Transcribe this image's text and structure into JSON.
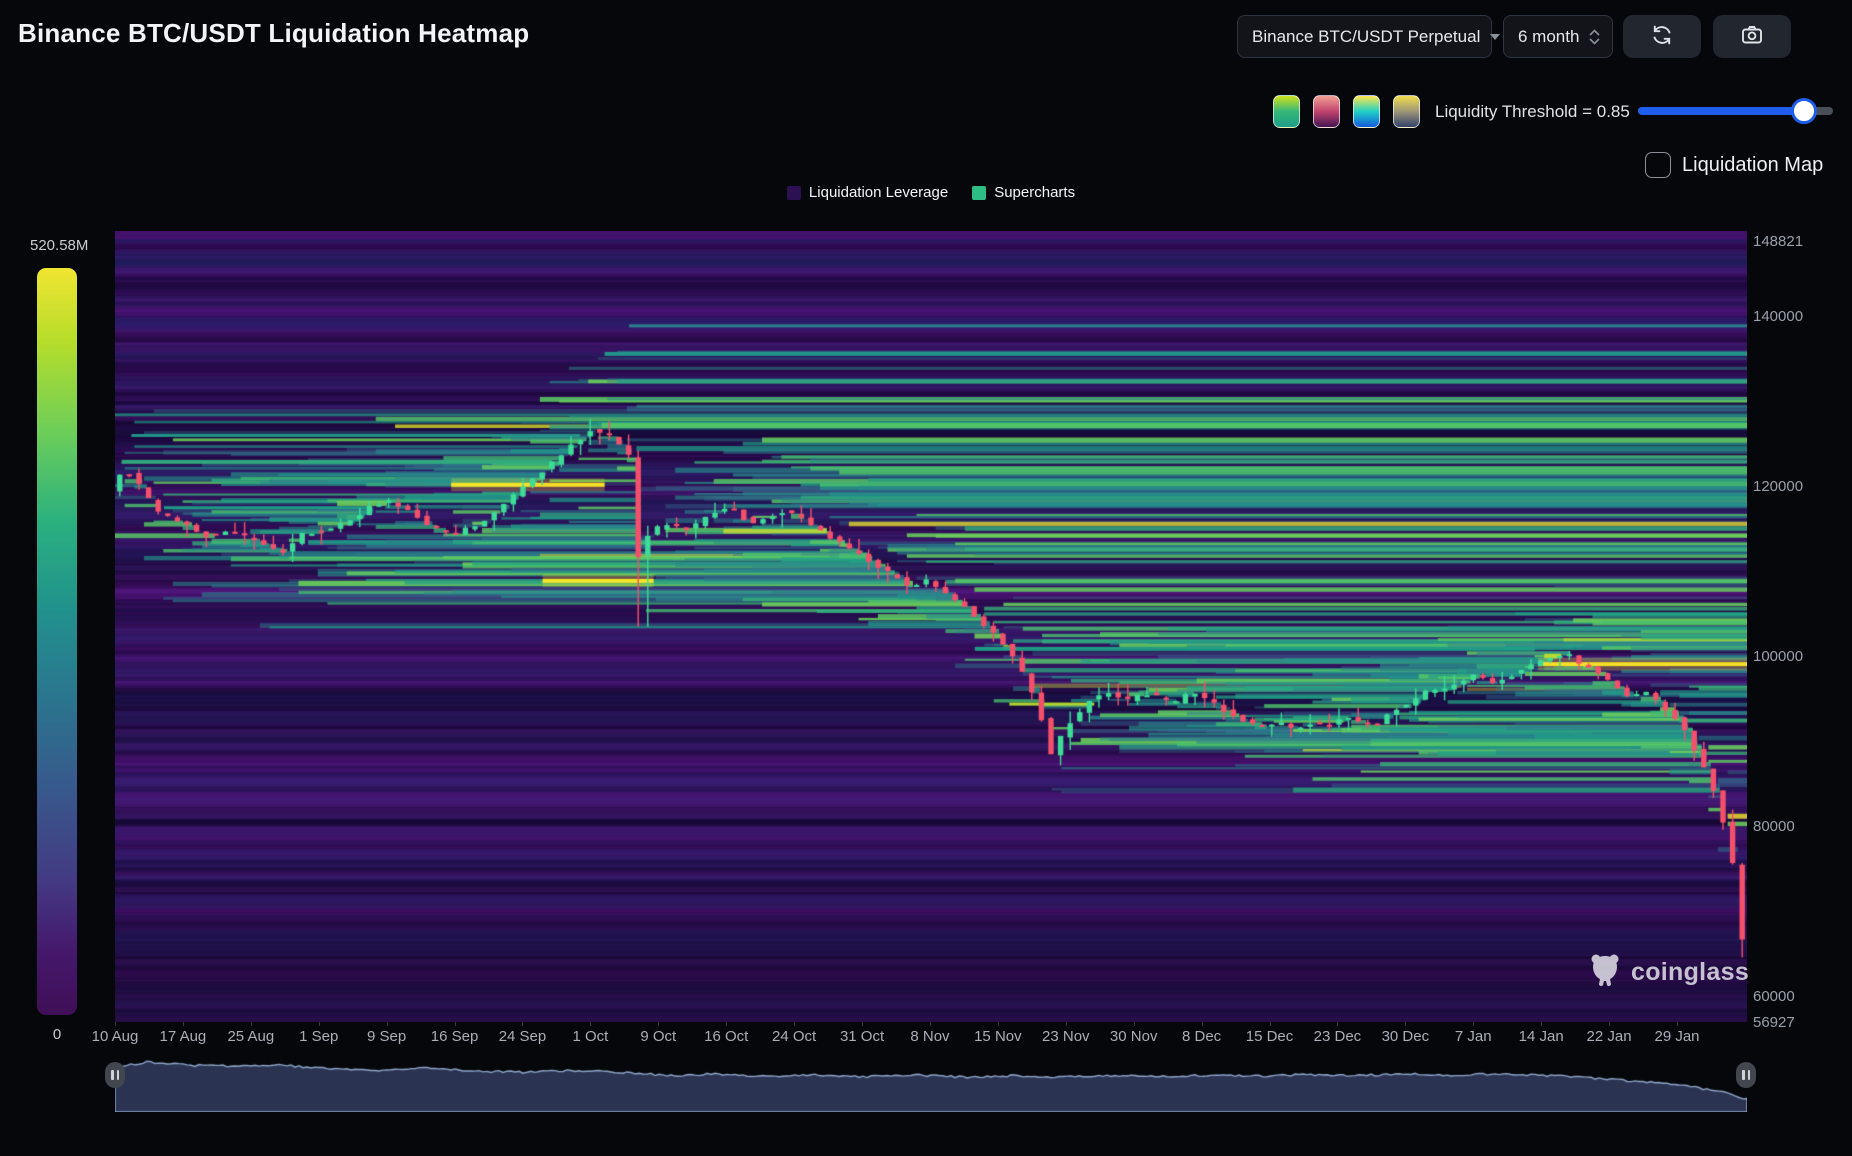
{
  "header": {
    "title": "Binance BTC/USDT Liquidation Heatmap"
  },
  "toolbar": {
    "symbol_select_value": "Binance BTC/USDT Perpetual",
    "range_select_value": "6 month"
  },
  "controls": {
    "threshold_label": "Liquidity Threshold = 0.85",
    "threshold_value": 0.85,
    "accent_blue": "#1f5eec",
    "palettes": [
      {
        "name": "viridis",
        "gradient": [
          "#cfe11e",
          "#35b779",
          "#1f9e89"
        ]
      },
      {
        "name": "magma",
        "gradient": [
          "#f2a093",
          "#c0436f",
          "#431453"
        ]
      },
      {
        "name": "ocean",
        "gradient": [
          "#ffe94d",
          "#20d0c4",
          "#1459dd"
        ]
      },
      {
        "name": "cividis",
        "gradient": [
          "#f3dd4d",
          "#9c9677",
          "#33426b"
        ]
      }
    ],
    "map_checkbox_label": "Liquidation Map",
    "map_checkbox_checked": false
  },
  "legend": [
    {
      "label": "Liquidation Leverage",
      "color": "#2d1052"
    },
    {
      "label": "Supercharts",
      "color": "#2ebd85"
    }
  ],
  "watermark": {
    "text": "coinglass"
  },
  "chart_data": {
    "type": "heatmap",
    "title": "Binance BTC/USDT Liquidation Heatmap",
    "colorbar": {
      "max_label": "520.58M",
      "min_label": "0"
    },
    "palette_stops": [
      "#440154",
      "#48327e",
      "#3e5c8a",
      "#31798e",
      "#26908d",
      "#1fa187",
      "#4ac16d",
      "#6dce59",
      "#b4de2c",
      "#fde725"
    ],
    "y_axis": {
      "side": "right",
      "min": 56927,
      "max": 148821,
      "ticks": [
        "148821",
        "140000",
        "120000",
        "100000",
        "80000",
        "60000",
        "56927"
      ]
    },
    "x_axis": {
      "labels": [
        "10 Aug",
        "17 Aug",
        "25 Aug",
        "1 Sep",
        "9 Sep",
        "16 Sep",
        "24 Sep",
        "1 Oct",
        "9 Oct",
        "16 Oct",
        "24 Oct",
        "31 Oct",
        "8 Nov",
        "15 Nov",
        "23 Nov",
        "30 Nov",
        "8 Dec",
        "15 Dec",
        "23 Dec",
        "30 Dec",
        "7 Jan",
        "14 Jan",
        "22 Jan",
        "29 Jan"
      ]
    },
    "candle_up_color": "#3ddc97",
    "candle_down_color": "#f4506b",
    "background_color": "#43106a",
    "price_path": [
      [
        0,
        118600
      ],
      [
        0.008,
        121200
      ],
      [
        0.018,
        119000
      ],
      [
        0.03,
        115800
      ],
      [
        0.045,
        114600
      ],
      [
        0.06,
        113100
      ],
      [
        0.075,
        113700
      ],
      [
        0.09,
        112400
      ],
      [
        0.105,
        111300
      ],
      [
        0.118,
        113400
      ],
      [
        0.132,
        113900
      ],
      [
        0.147,
        115000
      ],
      [
        0.162,
        116900
      ],
      [
        0.172,
        117300
      ],
      [
        0.183,
        116200
      ],
      [
        0.196,
        114200
      ],
      [
        0.21,
        113400
      ],
      [
        0.225,
        114500
      ],
      [
        0.24,
        116700
      ],
      [
        0.255,
        119300
      ],
      [
        0.27,
        121700
      ],
      [
        0.284,
        124100
      ],
      [
        0.296,
        125800
      ],
      [
        0.306,
        124800
      ],
      [
        0.314,
        123600
      ],
      [
        0.319,
        122200
      ],
      [
        0.323,
        110600
      ],
      [
        0.328,
        113200
      ],
      [
        0.34,
        114700
      ],
      [
        0.355,
        114000
      ],
      [
        0.37,
        115900
      ],
      [
        0.38,
        116500
      ],
      [
        0.392,
        114600
      ],
      [
        0.402,
        115200
      ],
      [
        0.412,
        116100
      ],
      [
        0.422,
        115500
      ],
      [
        0.436,
        113600
      ],
      [
        0.45,
        112000
      ],
      [
        0.465,
        110200
      ],
      [
        0.478,
        108700
      ],
      [
        0.49,
        107100
      ],
      [
        0.5,
        107900
      ],
      [
        0.512,
        106300
      ],
      [
        0.523,
        104900
      ],
      [
        0.533,
        103200
      ],
      [
        0.543,
        101300
      ],
      [
        0.552,
        99200
      ],
      [
        0.56,
        96800
      ],
      [
        0.568,
        93600
      ],
      [
        0.573,
        89800
      ],
      [
        0.577,
        87200
      ],
      [
        0.583,
        89900
      ],
      [
        0.591,
        91900
      ],
      [
        0.601,
        94000
      ],
      [
        0.612,
        94700
      ],
      [
        0.622,
        93700
      ],
      [
        0.632,
        94700
      ],
      [
        0.642,
        94300
      ],
      [
        0.652,
        93400
      ],
      [
        0.662,
        94900
      ],
      [
        0.673,
        93900
      ],
      [
        0.684,
        92400
      ],
      [
        0.696,
        91300
      ],
      [
        0.706,
        90700
      ],
      [
        0.716,
        91300
      ],
      [
        0.726,
        90300
      ],
      [
        0.736,
        91200
      ],
      [
        0.746,
        90800
      ],
      [
        0.756,
        91900
      ],
      [
        0.766,
        91200
      ],
      [
        0.776,
        91000
      ],
      [
        0.786,
        92700
      ],
      [
        0.796,
        93400
      ],
      [
        0.806,
        94900
      ],
      [
        0.816,
        95100
      ],
      [
        0.826,
        95800
      ],
      [
        0.836,
        96900
      ],
      [
        0.846,
        95800
      ],
      [
        0.856,
        96500
      ],
      [
        0.866,
        97600
      ],
      [
        0.876,
        98400
      ],
      [
        0.886,
        99100
      ],
      [
        0.892,
        99500
      ],
      [
        0.901,
        98000
      ],
      [
        0.911,
        97200
      ],
      [
        0.921,
        95600
      ],
      [
        0.931,
        94200
      ],
      [
        0.941,
        94900
      ],
      [
        0.951,
        93100
      ],
      [
        0.959,
        91800
      ],
      [
        0.966,
        89800
      ],
      [
        0.973,
        87200
      ],
      [
        0.981,
        84000
      ],
      [
        0.988,
        79800
      ],
      [
        0.994,
        74800
      ],
      [
        0.998,
        69800
      ],
      [
        1,
        65800
      ]
    ],
    "wick_lows": [
      {
        "t": 0.323,
        "low": 102500
      },
      {
        "t": 1,
        "low": 63600
      }
    ],
    "explicit_bands": [
      {
        "price": 126200,
        "from": 0.298,
        "to": 1,
        "intensity": 0.7,
        "height": 5
      },
      {
        "price": 134600,
        "from": 0.3,
        "to": 1,
        "intensity": 0.5,
        "height": 4
      },
      {
        "price": 137900,
        "from": 0.315,
        "to": 1,
        "intensity": 0.4,
        "height": 3
      },
      {
        "price": 119200,
        "from": 0.206,
        "to": 0.3,
        "intensity": 1.0,
        "height": 4
      },
      {
        "price": 107900,
        "from": 0.262,
        "to": 0.33,
        "intensity": 1.0,
        "height": 4
      },
      {
        "price": 98100,
        "from": 0.872,
        "to": 1,
        "intensity": 1.0,
        "height": 4
      },
      {
        "price": 93400,
        "from": 0.548,
        "to": 0.6,
        "intensity": 0.9,
        "height": 3
      },
      {
        "price": 99900,
        "from": 0.527,
        "to": 0.87,
        "intensity": 0.55,
        "height": 4
      },
      {
        "price": 104300,
        "from": 0.43,
        "to": 0.525,
        "intensity": 0.6,
        "height": 3
      },
      {
        "price": 121900,
        "from": 0.004,
        "to": 0.268,
        "intensity": 0.6,
        "height": 4
      },
      {
        "price": 125000,
        "from": 0.01,
        "to": 0.285,
        "intensity": 0.5,
        "height": 3
      },
      {
        "price": 116500,
        "from": 0.03,
        "to": 0.155,
        "intensity": 0.55,
        "height": 3
      }
    ],
    "navigator": {
      "fill": "#2a3352",
      "line": "#8fa6c9",
      "points": [
        [
          0,
          0.86
        ],
        [
          0.02,
          0.96
        ],
        [
          0.045,
          0.9
        ],
        [
          0.07,
          0.88
        ],
        [
          0.1,
          0.9
        ],
        [
          0.13,
          0.84
        ],
        [
          0.16,
          0.8
        ],
        [
          0.19,
          0.84
        ],
        [
          0.22,
          0.79
        ],
        [
          0.25,
          0.76
        ],
        [
          0.28,
          0.8
        ],
        [
          0.31,
          0.76
        ],
        [
          0.34,
          0.7
        ],
        [
          0.37,
          0.73
        ],
        [
          0.4,
          0.69
        ],
        [
          0.43,
          0.71
        ],
        [
          0.46,
          0.68
        ],
        [
          0.49,
          0.71
        ],
        [
          0.52,
          0.67
        ],
        [
          0.55,
          0.7
        ],
        [
          0.58,
          0.67
        ],
        [
          0.61,
          0.7
        ],
        [
          0.64,
          0.68
        ],
        [
          0.67,
          0.71
        ],
        [
          0.7,
          0.69
        ],
        [
          0.73,
          0.72
        ],
        [
          0.76,
          0.7
        ],
        [
          0.79,
          0.73
        ],
        [
          0.82,
          0.71
        ],
        [
          0.85,
          0.74
        ],
        [
          0.88,
          0.7
        ],
        [
          0.9,
          0.66
        ],
        [
          0.92,
          0.62
        ],
        [
          0.94,
          0.58
        ],
        [
          0.96,
          0.52
        ],
        [
          0.975,
          0.44
        ],
        [
          0.985,
          0.38
        ],
        [
          0.993,
          0.3
        ],
        [
          1,
          0.24
        ]
      ]
    }
  }
}
